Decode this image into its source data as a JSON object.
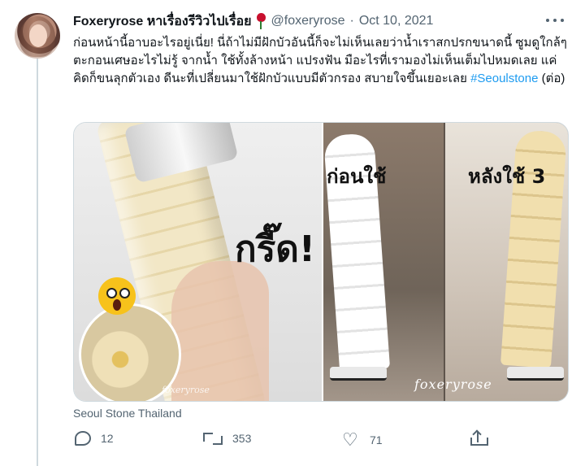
{
  "tweet": {
    "display_name": "Foxeryrose หาเรื่องรีวิวไปเรื่อย",
    "emoji_icon": "rose-icon",
    "handle": "@foxeryrose",
    "separator": "·",
    "date": "Oct 10, 2021",
    "text": "ก่อนหน้านี้อาบอะไรอยู่เนี่ย! นี่ถ้าไม่มีฝักบัวอันนี้ก็จะไม่เห็นเลยว่าน้ำเราสกปรกขนาดนี้ ซูมดูใกล้ๆ ตะกอนเศษอะไรไม่รู้ จากน้ำ ใช้ทั้งล้างหน้า แปรงฟัน มือะไรที่เรามองไม่เห็นเต็มไปหมดเลย แค่คิดก็ขนลุกตัวเอง ดีนะที่เปลี่ยนมาใช้ฝักบัวแบบมีตัวกรอง สบายใจขึ้นเยอะเลย ",
    "hashtag": "#Seoulstone",
    "suffix": " (ต่อ)"
  },
  "media": {
    "left_overlay": "กรี๊ด!",
    "left_watermark": "foxeryrose",
    "before_label": "ก่อนใช้",
    "after_label": "หลังใช้ 3",
    "right_watermark": "foxeryrose"
  },
  "caption": "Seoul Stone Thailand",
  "actions": {
    "replies": "12",
    "retweets": "353",
    "likes": "71"
  },
  "colors": {
    "link": "#1d9bf0",
    "secondary": "#536471"
  }
}
